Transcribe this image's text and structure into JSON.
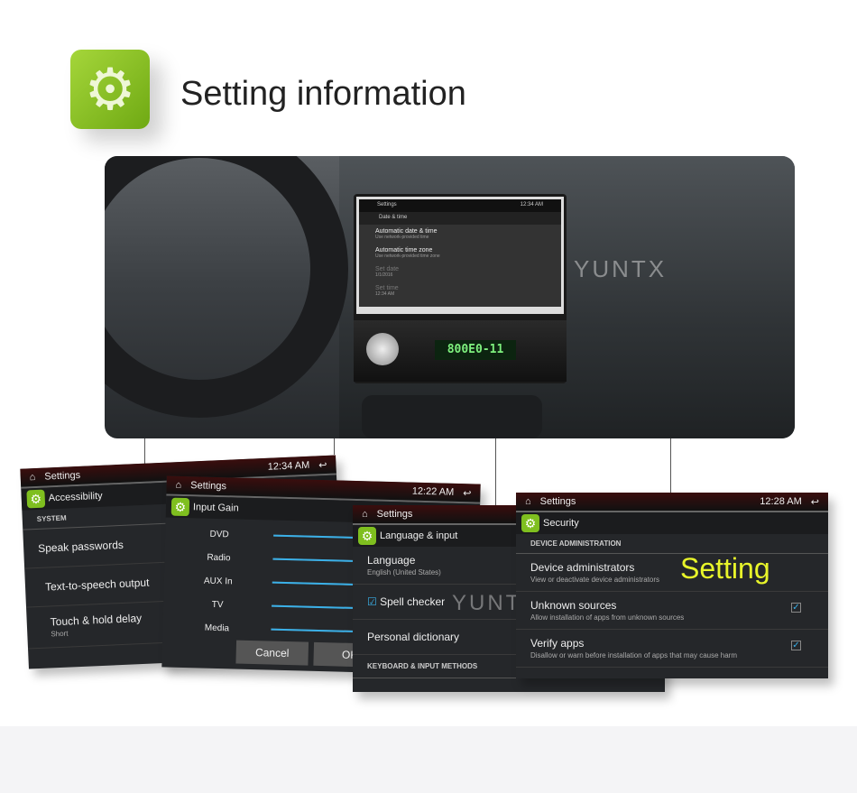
{
  "header": {
    "icon": "gear-icon",
    "title": "Setting information"
  },
  "photo": {
    "watermark": "YUNTX",
    "lcd": "800E0-11",
    "screen": {
      "app": "Settings",
      "time": "12:34 AM",
      "section": "Date & time",
      "items": [
        {
          "title": "Automatic date & time",
          "sub": "Use network-provided time",
          "checked": true
        },
        {
          "title": "Automatic time zone",
          "sub": "Use network-provided time zone",
          "checked": true
        },
        {
          "title": "Set date",
          "sub": "1/1/2016"
        },
        {
          "title": "Set time",
          "sub": "12:34 AM"
        }
      ]
    }
  },
  "screens": {
    "accessibility": {
      "app": "Settings",
      "time": "12:34 AM",
      "section": "Accessibility",
      "group": "SYSTEM",
      "items": [
        {
          "title": "Speak passwords"
        },
        {
          "title": "Text-to-speech output"
        },
        {
          "title": "Touch & hold delay",
          "sub": "Short"
        }
      ]
    },
    "input_gain": {
      "app": "Settings",
      "time": "12:22 AM",
      "section": "Input Gain",
      "sliders": [
        {
          "label": "DVD",
          "value": 0.5
        },
        {
          "label": "Radio",
          "value": 0.5
        },
        {
          "label": "AUX In",
          "value": 0.5
        },
        {
          "label": "TV",
          "value": 0.5
        },
        {
          "label": "Media",
          "value": 1.0
        }
      ],
      "cancel": "Cancel",
      "ok": "OK"
    },
    "language": {
      "app": "Settings",
      "section": "Language & input",
      "lang_title": "Language",
      "lang_sub": "English (United States)",
      "spell": "Spell checker",
      "dict": "Personal dictionary",
      "group": "KEYBOARD & INPUT METHODS",
      "watermark": "YUNTX"
    },
    "security": {
      "app": "Settings",
      "time": "12:28 AM",
      "section": "Security",
      "group": "DEVICE ADMINISTRATION",
      "overlay": "Setting",
      "items": [
        {
          "title": "Device administrators",
          "sub": "View or deactivate device administrators"
        },
        {
          "title": "Unknown sources",
          "sub": "Allow installation of apps from unknown sources",
          "checked": true
        },
        {
          "title": "Verify apps",
          "sub": "Disallow or warn before installation of apps that may cause harm",
          "checked": true
        }
      ]
    }
  },
  "colors": {
    "accent": "#7fbf1f",
    "slider": "#3ab0e8",
    "overlay": "#e8f52a"
  }
}
